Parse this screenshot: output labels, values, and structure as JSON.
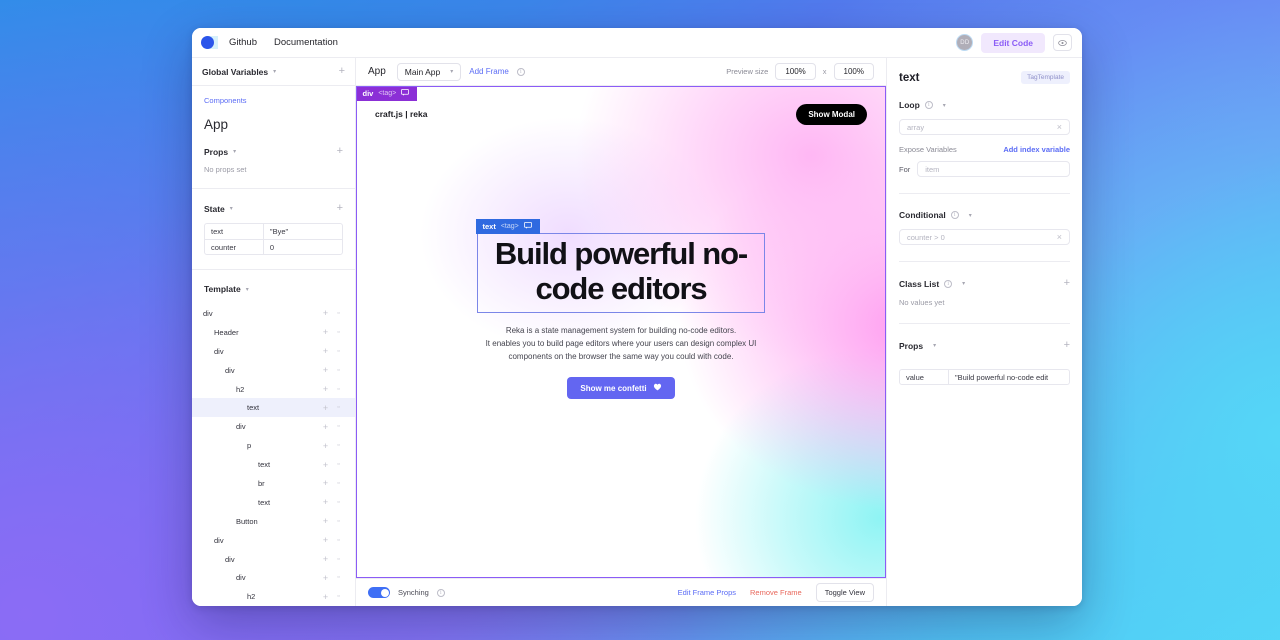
{
  "topbar": {
    "logo_icon": "reka-logo-icon",
    "nav": [
      {
        "label": "Github"
      },
      {
        "label": "Documentation"
      }
    ],
    "avatar_initials": "DD",
    "edit_code_label": "Edit Code",
    "eye_icon": "eye-icon"
  },
  "left_panel": {
    "global_variables": {
      "label": "Global Variables",
      "chevron_icon": "chevron-down-icon",
      "add_icon": "plus-icon"
    },
    "components_link": "Components",
    "app_title": "App",
    "props": {
      "label": "Props",
      "chevron_icon": "chevron-down-icon",
      "add_icon": "plus-icon",
      "empty": "No props set"
    },
    "state": {
      "label": "State",
      "chevron_icon": "chevron-down-icon",
      "add_icon": "plus-icon",
      "rows": [
        {
          "key": "text",
          "value": "\"Bye\""
        },
        {
          "key": "counter",
          "value": "0"
        }
      ]
    },
    "template": {
      "label": "Template",
      "chevron_icon": "chevron-down-icon",
      "nodes": [
        {
          "label": "div",
          "depth": 0,
          "selected": false
        },
        {
          "label": "Header",
          "depth": 1,
          "selected": false
        },
        {
          "label": "div",
          "depth": 1,
          "selected": false
        },
        {
          "label": "div",
          "depth": 2,
          "selected": false
        },
        {
          "label": "h2",
          "depth": 3,
          "selected": false
        },
        {
          "label": "text",
          "depth": 4,
          "selected": true
        },
        {
          "label": "div",
          "depth": 3,
          "selected": false
        },
        {
          "label": "p",
          "depth": 4,
          "selected": false
        },
        {
          "label": "text",
          "depth": 5,
          "selected": false
        },
        {
          "label": "br",
          "depth": 5,
          "selected": false
        },
        {
          "label": "text",
          "depth": 5,
          "selected": false
        },
        {
          "label": "Button",
          "depth": 3,
          "selected": false
        },
        {
          "label": "div",
          "depth": 1,
          "selected": false
        },
        {
          "label": "div",
          "depth": 2,
          "selected": false
        },
        {
          "label": "div",
          "depth": 3,
          "selected": false
        },
        {
          "label": "h2",
          "depth": 4,
          "selected": false
        }
      ],
      "row_add_icon": "plus-icon",
      "row_more_icon": "square-icon"
    }
  },
  "canvas": {
    "header": {
      "app_label": "App",
      "frame_select_value": "Main App",
      "frame_chevron_icon": "chevron-down-icon",
      "add_frame_label": "Add Frame",
      "add_frame_info_icon": "info-icon",
      "preview_size_label": "Preview size",
      "preview_width": "100%",
      "preview_separator": "x",
      "preview_height": "100%"
    },
    "frame": {
      "selected_tag": {
        "name": "div",
        "tag": "<tag>",
        "comment_icon": "comment-icon"
      },
      "brand": "craft.js | reka",
      "show_modal_label": "Show Modal",
      "hero_tag": {
        "name": "text",
        "tag": "<tag>",
        "comment_icon": "comment-icon"
      },
      "heading": "Build powerful no-code editors",
      "paragraph_line1": "Reka is a state management system for building no-code editors.",
      "paragraph_line2": "It enables you to build page editors where your users can design complex UI",
      "paragraph_line3": "components on the browser the same way you could with code.",
      "confetti_label": "Show me confetti",
      "confetti_icon": "heart-icon"
    },
    "footer": {
      "sync_toggle_icon": "toggle-on-icon",
      "sync_label": "Synching",
      "sync_info_icon": "info-icon",
      "edit_frame_props": "Edit Frame Props",
      "remove_frame": "Remove Frame",
      "toggle_view": "Toggle View"
    }
  },
  "right_panel": {
    "title": "text",
    "badge": "TagTemplate",
    "loop": {
      "label": "Loop",
      "info_icon": "info-icon",
      "chevron_icon": "chevron-down-icon",
      "array_placeholder": "array",
      "clear_icon": "close-icon",
      "expose_label": "Expose Variables",
      "add_index_label": "Add index variable",
      "for_label": "For",
      "for_placeholder": "item"
    },
    "conditional": {
      "label": "Conditional",
      "info_icon": "info-icon",
      "chevron_icon": "chevron-down-icon",
      "placeholder": "counter > 0",
      "clear_icon": "close-icon"
    },
    "class_list": {
      "label": "Class List",
      "info_icon": "info-icon",
      "chevron_icon": "chevron-down-icon",
      "add_icon": "plus-icon",
      "empty": "No values yet"
    },
    "props": {
      "label": "Props",
      "chevron_icon": "chevron-down-icon",
      "add_icon": "plus-icon",
      "rows": [
        {
          "key": "value",
          "value": "\"Build powerful no-code edit"
        }
      ]
    }
  },
  "colors": {
    "accent_purple": "#8b5cf6",
    "accent_indigo": "#6366f1",
    "link_blue": "#5b6cf5",
    "danger_red": "#e8685c",
    "tag_div_purple": "#8b2fd6",
    "tag_text_blue": "#2f6ae0"
  }
}
